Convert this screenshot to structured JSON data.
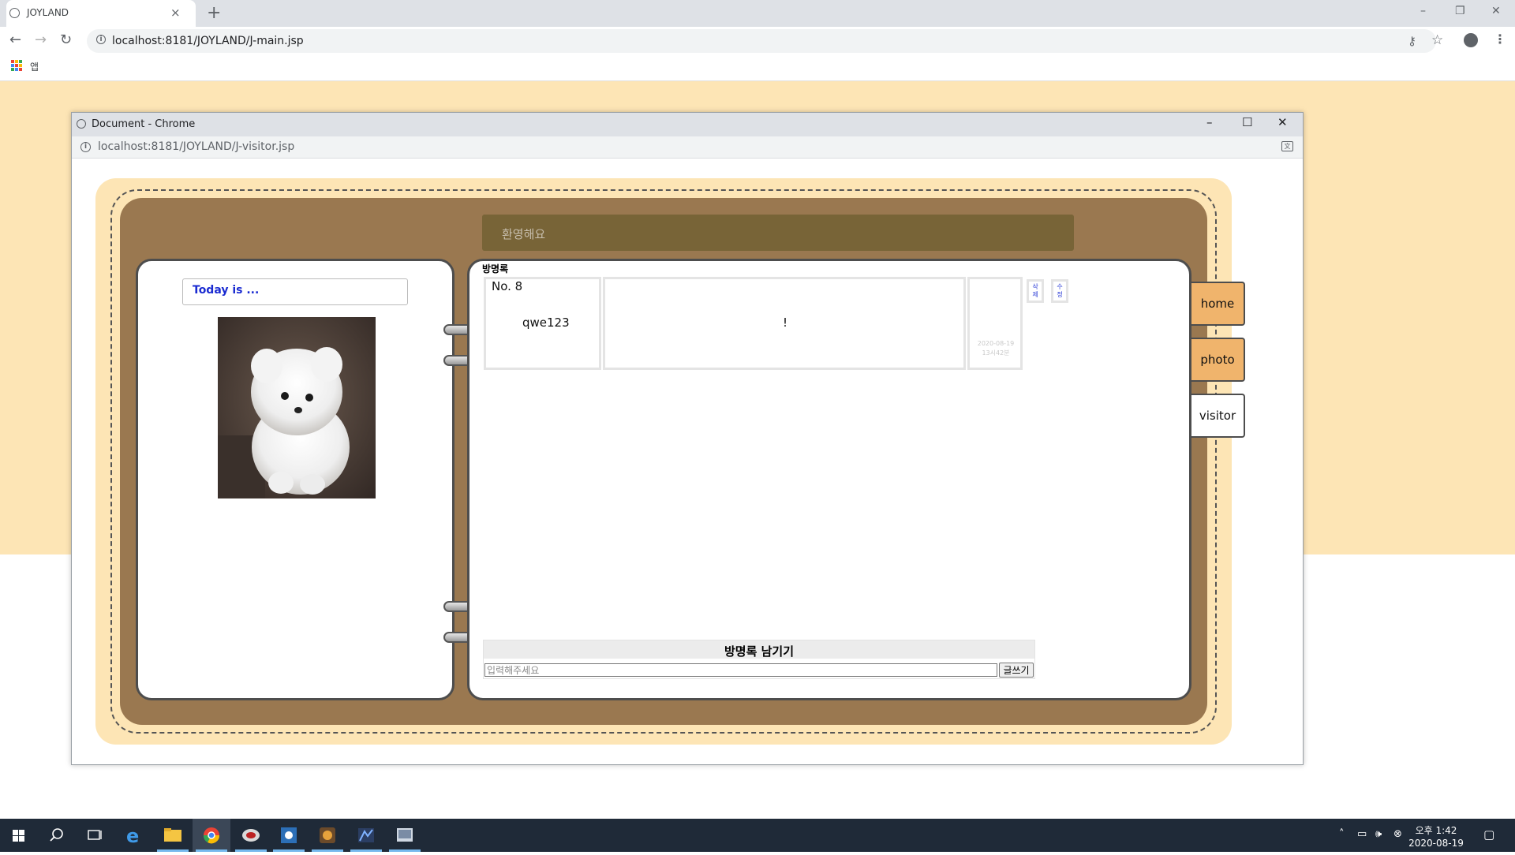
{
  "browser": {
    "tab_title": "JOYLAND",
    "tab_close": "×",
    "new_tab": "+",
    "url": "localhost:8181/JOYLAND/J-main.jsp",
    "bookmarks_apps_label": "앱",
    "window_controls": {
      "minimize": "–",
      "restore": "❐",
      "close": "✕"
    }
  },
  "popup": {
    "title": "Document - Chrome",
    "url": "localhost:8181/JOYLAND/J-visitor.jsp",
    "controls": {
      "minimize": "–",
      "maximize": "☐",
      "close": "✕"
    }
  },
  "diary": {
    "welcome": "환영해요",
    "today_label": "Today is ...",
    "guestbook_title": "방명록",
    "entry": {
      "number": "No. 8",
      "writer": "qwe123",
      "content": "!",
      "date_line1": "2020-08-19",
      "date_line2": "13시42분",
      "delete_label": "삭제",
      "edit_label": "수정"
    },
    "write": {
      "title": "방명록 남기기",
      "placeholder": "입력해주세요",
      "value": "",
      "submit_label": "글쓰기"
    },
    "tabs": [
      {
        "label": "home",
        "active": false
      },
      {
        "label": "photo",
        "active": false
      },
      {
        "label": "visitor",
        "active": true
      }
    ]
  },
  "taskbar": {
    "time": "오후 1:42",
    "date": "2020-08-19"
  },
  "colors": {
    "page_background": "#fde5b5",
    "diary_brown": "#9a7850",
    "welcome_bar": "#786437",
    "tab_orange": "#f0b46c",
    "today_text": "#1a2bd1",
    "taskbar": "#1f2a38"
  },
  "icons": [
    "globe-icon",
    "close-icon",
    "plus-icon",
    "back-arrow-icon",
    "forward-arrow-icon",
    "reload-icon",
    "info-icon",
    "key-icon",
    "star-icon",
    "profile-icon",
    "kebab-menu-icon",
    "apps-grid-icon",
    "translate-icon",
    "windows-start-icon",
    "search-icon",
    "task-view-icon",
    "edge-icon",
    "file-explorer-icon",
    "chrome-icon"
  ]
}
